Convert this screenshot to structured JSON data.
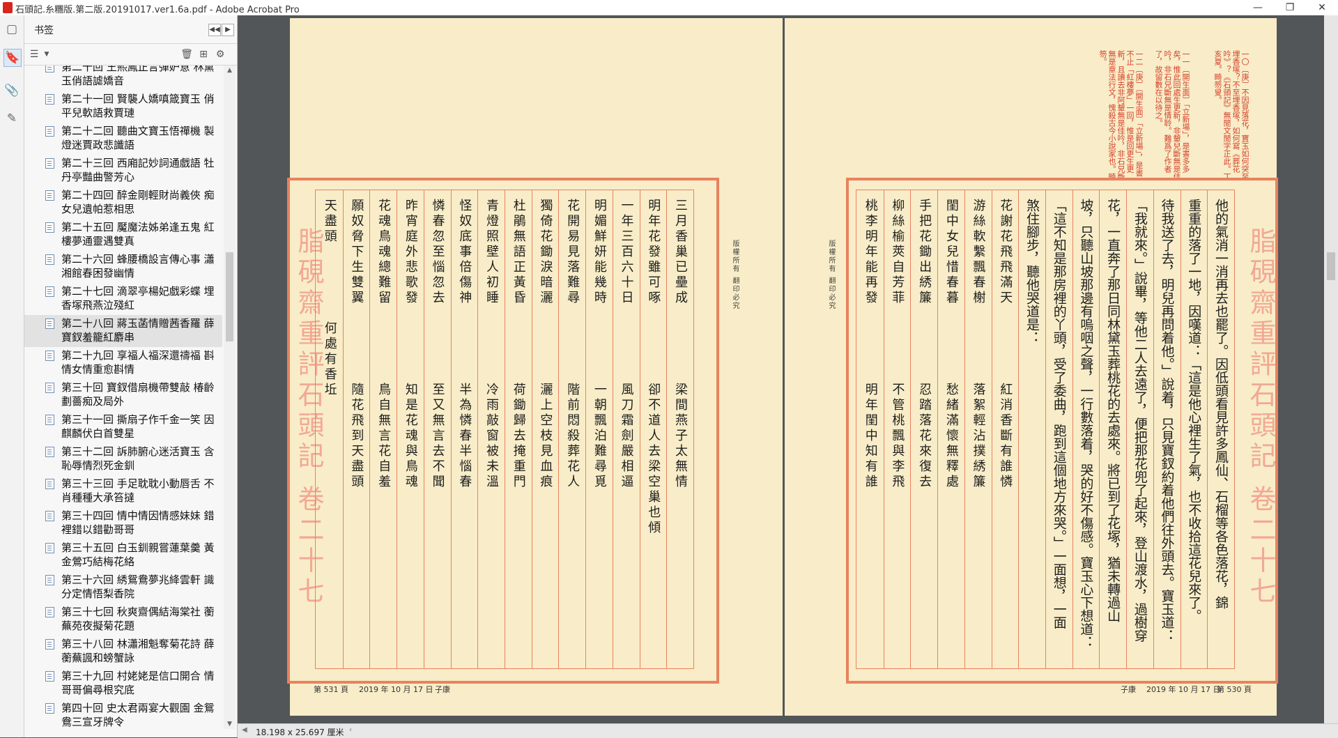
{
  "window": {
    "title": "石頭記.糸糰版.第二版.20191017.ver1.6a.pdf - Adobe Acrobat Pro",
    "minimize": "—",
    "restore": "❐",
    "close": "✕"
  },
  "panel": {
    "title": "书签",
    "bookmarks": [
      "第二十回 王熙鳳正言彈妒意 林黛玉俏語謔嬌音",
      "第二十一回 賢襲人嬌嗔箴寶玉 俏平兒軟語救賈璉",
      "第二十二回 聽曲文寶玉悟禪機 製燈迷賈政悲讖語",
      "第二十三回 西廂記妙詞通戲語 牡丹亭豔曲警芳心",
      "第二十四回 醉金剛輕財尚義俠 痴女兒遺帕惹相思",
      "第二十五回 魘魔法姊弟逢五鬼 紅樓夢通靈遇雙真",
      "第二十六回 蜂腰橋設言傳心事 瀟湘館春困發幽情",
      "第二十七回 滴翠亭楊妃戲彩蝶 埋香塚飛燕泣殘紅",
      "第二十八回 蔣玉菡情贈茜香羅 薛寶釵羞籠紅麝串",
      "第二十九回 享福人福深還禱福 斟情女情重愈斟情",
      "第三十回 寶釵借扇機帶雙敲 椿齡劃薔痴及局外",
      "第三十一回 撕扇子作千金一笑 因麒麟伏白首雙星",
      "第三十二回 訴肺腑心迷活寶玉 含恥辱情烈死金釧",
      "第三十三回 手足耽耽小動唇舌 不肖種種大承笞撻",
      "第三十四回 情中情因情感妹妹 錯裡錯以錯勸哥哥",
      "第三十五回 白玉釧親嘗蓮葉羹 黃金鶯巧結梅花絡",
      "第三十六回 綉鴛鴦夢兆絳雲軒 識分定情悟梨香院",
      "第三十七回 秋爽齋偶結海棠社 蘅蕪苑夜擬菊花題",
      "第三十八回 林瀟湘魁奪菊花詩 薛蘅蕪諷和螃蟹詠",
      "第三十九回 村姥姥是信口開合 情哥哥偏尋根究底",
      "第四十回 史太君兩宴大觀園 金鴛鴦三宣牙牌令"
    ],
    "selected_index": 8
  },
  "left_page": {
    "banner": "脂硯齋重評石頭記 卷二十七",
    "side_text": "版權所有  翻印必究",
    "columns": [
      "三月香巢已壘成　　　　　梁間燕子太無情",
      "明年花發雖可啄　　　　　卻不道人去梁空巢也傾",
      "一年三百六十日　　　　　風刀霜劍嚴相逼",
      "明媚鮮妍能幾時　　　　　一朝飄泊難尋覓",
      "花開易見落難尋　　　　　階前悶殺葬花人",
      "獨倚花鋤淚暗灑　　　　　灑上空枝見血痕",
      "杜鵑無語正黃昏　　　　　荷鋤歸去掩重門",
      "青燈照壁人初睡　　　　　冷雨敲窗被未溫",
      "怪奴底事倍傷神　　　　　半為憐春半惱春",
      "憐春忽至惱忽去　　　　　至又無言去不聞",
      "昨宵庭外悲歌發　　　　　知是花魂與鳥魂",
      "花魂鳥魂總難留　　　　　鳥自無言花自羞",
      "願奴脅下生雙翼　　　　　隨花飛到天盡頭",
      "天盡頭　　　　　何處有香坵"
    ],
    "footer": {
      "page": "第 531 頁",
      "date": "2019 年 10 月 17 日",
      "author": "子康"
    }
  },
  "right_page": {
    "banner": "脂硯齋重評石頭記 卷二十七",
    "side_text": "版權所有  翻印必究",
    "notes": [
      "一〇〔庚〕不因見落花，寶玉如何突至埋香塚？不至埋香塚，如何寫《葬花吟》？《石頭記》無閒文閒字正此。丁亥夏。畸笏叟。",
      "一一〔開生面〕「立新場」，是書多多矣，惟此回處生更新，非顰兒斷無是佳吟，非石兄斷無是情聆。難爲了作者了，故留數在以待之。",
      "一二〔庚〕〔開生面〕「立新場」，是書不止「紅樓夢」一回，惟是回更生更新，且讀去非阿顰無是佳吟，非石兄斷無是章法行文，愧殺古今小說家也。畸笏。"
    ],
    "columns": [
      "他的氣消一消再去也罷了。因低頭看見許多鳳仙、石榴等各色落花，錦",
      "重重的落了一地，因嘆道：「這是他心裡生了氣，也不收拾這花兒來了。",
      "待我送了去，明兒再問着他。」說着，只見寶釵約着他們往外頭去。寶玉道：",
      "「我就來。」說畢，等他二人去遠了，便把那花兜了起來，登山渡水，過樹穿",
      "花，一直奔了那日同林黛玉葬桃花的去處來。將已到了花塚，猶未轉過山",
      "坡，只聽山坡那邊有嗚咽之聲，一行數落着，哭的好不傷感。寶玉心下想道：",
      "「這不知是那房裡的丫頭，受了委曲，跑到這個地方來哭。」一面想，一面",
      "煞住腳步，聽他哭道是：",
      "花謝花飛飛滿天　　　　　紅消香斷有誰憐",
      "游絲軟繫飄春榭　　　　　落絮輕沾撲綉簾",
      "閨中女兒惜春暮　　　　　愁緒滿懷無釋處",
      "手把花鋤出綉簾　　　　　忍踏落花來復去",
      "柳絲榆莢自芳菲　　　　　不管桃飄與李飛",
      "桃李明年能再發　　　　　明年閨中知有誰"
    ],
    "footer": {
      "page": "第 530 頁",
      "date": "2019 年 10 月 17 日",
      "author": "子康"
    }
  },
  "status": {
    "page_size": "18.198 x 25.697 厘米"
  }
}
